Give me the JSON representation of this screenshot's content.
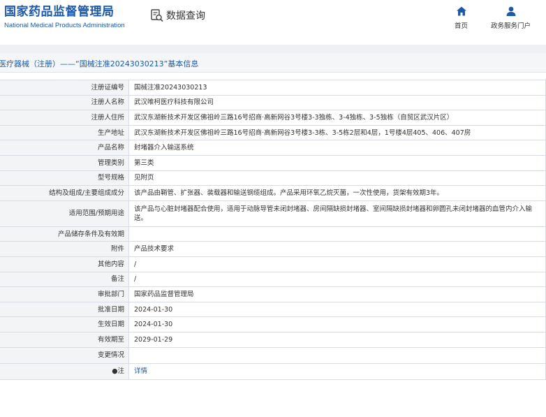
{
  "header": {
    "brand_cn": "国家药品监督管理局",
    "brand_en": "National Medical Products Administration",
    "query_label": "数据查询",
    "nav": [
      {
        "label": "首页",
        "icon": "home-icon"
      },
      {
        "label": "政务服务门户",
        "icon": "user-icon"
      }
    ]
  },
  "breadcrumb": "医疗器械（注册）——“国械注准20243030213”基本信息",
  "colors": {
    "brand": "#1c5aa8",
    "label_bg": "#f3f4f6",
    "border": "#d8dde5"
  },
  "rows": [
    {
      "label": "注册证编号",
      "value": "国械注准20243030213"
    },
    {
      "label": "注册人名称",
      "value": "武汉唯柯医疗科技有限公司"
    },
    {
      "label": "注册人住所",
      "value": "武汉东湖新技术开发区佛祖岭三路16号招商·高新网谷3号楼3-3独栋、3-4独栋、3-5独栋（自贸区武汉片区）"
    },
    {
      "label": "生产地址",
      "value": "武汉东湖新技术开发区佛祖岭三路16号招商·高新网谷3号楼3-3栋、3-5栋2层和4层，1号楼4层405、406、407房"
    },
    {
      "label": "产品名称",
      "value": "封堵器介入输送系统"
    },
    {
      "label": "管理类别",
      "value": "第三类"
    },
    {
      "label": "型号规格",
      "value": "见附页"
    },
    {
      "label": "结构及组成/主要组成成分",
      "value": "该产品由鞘管、扩张器、装载器和输送钢缆组成。产品采用环氧乙烷灭菌，一次性使用，货架有效期3年。"
    },
    {
      "label": "适用范围/预期用途",
      "value": "该产品与心脏封堵器配合使用，适用于动脉导管未闭封堵器、房间隔缺损封堵器、室间隔缺损封堵器和卵圆孔未闭封堵器的血管内介入输送。"
    },
    {
      "label": "产品储存条件及有效期",
      "value": ""
    },
    {
      "label": "附件",
      "value": "产品技术要求"
    },
    {
      "label": "其他内容",
      "value": "/"
    },
    {
      "label": "备注",
      "value": "/"
    },
    {
      "label": "审批部门",
      "value": "国家药品监督管理局"
    },
    {
      "label": "批准日期",
      "value": "2024-01-30"
    },
    {
      "label": "生效日期",
      "value": "2024-01-30"
    },
    {
      "label": "有效期至",
      "value": "2029-01-29"
    },
    {
      "label": "变更情况",
      "value": ""
    },
    {
      "label": "●注",
      "value": "详情"
    }
  ]
}
